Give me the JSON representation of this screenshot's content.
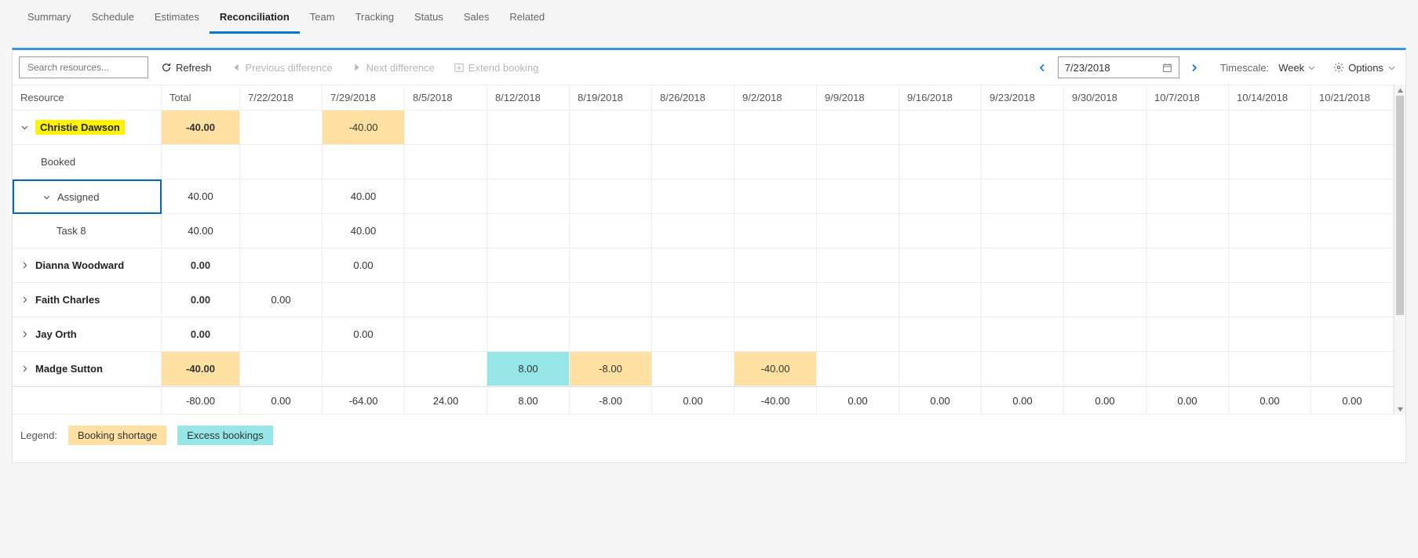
{
  "tabs": [
    "Summary",
    "Schedule",
    "Estimates",
    "Reconciliation",
    "Team",
    "Tracking",
    "Status",
    "Sales",
    "Related"
  ],
  "active_tab": 3,
  "toolbar": {
    "search_placeholder": "Search resources...",
    "refresh": "Refresh",
    "prev_diff": "Previous difference",
    "next_diff": "Next difference",
    "extend": "Extend booking",
    "date": "7/23/2018",
    "timescale_label": "Timescale:",
    "timescale_value": "Week",
    "options": "Options"
  },
  "columns": {
    "resource": "Resource",
    "total": "Total",
    "dates": [
      "7/22/2018",
      "7/29/2018",
      "8/5/2018",
      "8/12/2018",
      "8/19/2018",
      "8/26/2018",
      "9/2/2018",
      "9/9/2018",
      "9/16/2018",
      "9/23/2018",
      "9/30/2018",
      "10/7/2018",
      "10/14/2018",
      "10/21/2018"
    ]
  },
  "rows": [
    {
      "name": "Christie Dawson",
      "expanded": true,
      "highlight": true,
      "total": "-40.00",
      "total_cls": "shortage",
      "cells": [
        "",
        "-40.00",
        "",
        "",
        "",
        "",
        "",
        "",
        "",
        "",
        "",
        "",
        "",
        ""
      ],
      "cell_cls": [
        "",
        "shortage",
        "",
        "",
        "",
        "",
        "",
        "",
        "",
        "",
        "",
        "",
        "",
        ""
      ]
    },
    {
      "name": "Booked",
      "child": 1,
      "total": "",
      "cells": [
        "",
        "",
        "",
        "",
        "",
        "",
        "",
        "",
        "",
        "",
        "",
        "",
        "",
        ""
      ],
      "cell_cls": [
        "",
        "",
        "",
        "",
        "",
        "",
        "",
        "",
        "",
        "",
        "",
        "",
        "",
        ""
      ]
    },
    {
      "name": "Assigned",
      "child": 1,
      "expanded": true,
      "selected": true,
      "total": "40.00",
      "total_bold": false,
      "cells": [
        "",
        "40.00",
        "",
        "",
        "",
        "",
        "",
        "",
        "",
        "",
        "",
        "",
        "",
        ""
      ],
      "cell_cls": [
        "",
        "",
        "",
        "",
        "",
        "",
        "",
        "",
        "",
        "",
        "",
        "",
        "",
        ""
      ]
    },
    {
      "name": "Task 8",
      "child": 2,
      "total": "40.00",
      "total_bold": false,
      "cells": [
        "",
        "40.00",
        "",
        "",
        "",
        "",
        "",
        "",
        "",
        "",
        "",
        "",
        "",
        ""
      ],
      "cell_cls": [
        "",
        "",
        "",
        "",
        "",
        "",
        "",
        "",
        "",
        "",
        "",
        "",
        "",
        ""
      ]
    },
    {
      "name": "Dianna Woodward",
      "expanded": false,
      "total": "0.00",
      "cells": [
        "",
        "0.00",
        "",
        "",
        "",
        "",
        "",
        "",
        "",
        "",
        "",
        "",
        "",
        ""
      ],
      "cell_cls": [
        "",
        "",
        "",
        "",
        "",
        "",
        "",
        "",
        "",
        "",
        "",
        "",
        "",
        ""
      ]
    },
    {
      "name": "Faith Charles",
      "expanded": false,
      "total": "0.00",
      "cells": [
        "0.00",
        "",
        "",
        "",
        "",
        "",
        "",
        "",
        "",
        "",
        "",
        "",
        "",
        ""
      ],
      "cell_cls": [
        "",
        "",
        "",
        "",
        "",
        "",
        "",
        "",
        "",
        "",
        "",
        "",
        "",
        ""
      ]
    },
    {
      "name": "Jay Orth",
      "expanded": false,
      "total": "0.00",
      "cells": [
        "",
        "0.00",
        "",
        "",
        "",
        "",
        "",
        "",
        "",
        "",
        "",
        "",
        "",
        ""
      ],
      "cell_cls": [
        "",
        "",
        "",
        "",
        "",
        "",
        "",
        "",
        "",
        "",
        "",
        "",
        "",
        ""
      ]
    },
    {
      "name": "Madge Sutton",
      "expanded": false,
      "total": "-40.00",
      "total_cls": "shortage",
      "cells": [
        "",
        "",
        "",
        "8.00",
        "-8.00",
        "",
        "-40.00",
        "",
        "",
        "",
        "",
        "",
        "",
        ""
      ],
      "cell_cls": [
        "",
        "",
        "",
        "excess",
        "shortage",
        "",
        "shortage",
        "",
        "",
        "",
        "",
        "",
        "",
        ""
      ]
    }
  ],
  "summary": {
    "total": "-80.00",
    "cells": [
      "0.00",
      "-64.00",
      "24.00",
      "8.00",
      "-8.00",
      "0.00",
      "-40.00",
      "0.00",
      "0.00",
      "0.00",
      "0.00",
      "0.00",
      "0.00",
      "0.00"
    ]
  },
  "legend": {
    "label": "Legend:",
    "shortage": "Booking shortage",
    "excess": "Excess bookings"
  },
  "grid_template": "190px 100px repeat(14, 1fr) 15px"
}
